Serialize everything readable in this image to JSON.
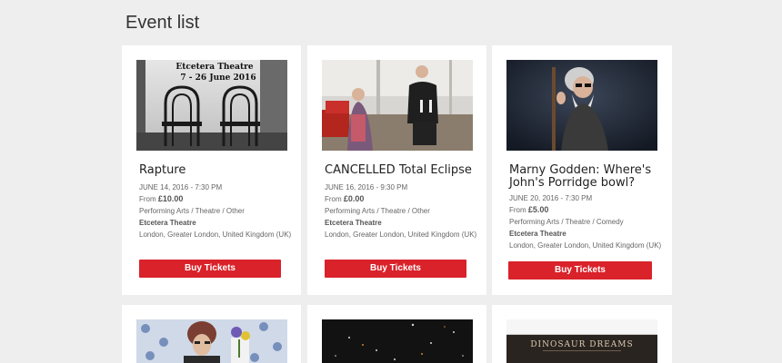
{
  "page": {
    "title": "Event list"
  },
  "events": [
    {
      "title": "Rapture",
      "date": "JUNE 14, 2016 - 7:30 PM",
      "price_prefix": "From",
      "price": "£10.00",
      "category": "Performing Arts / Theatre / Other",
      "venue": "Etcetera Theatre",
      "location": "London, Greater London, United Kingdom (UK)",
      "button_label": "Buy Tickets",
      "image_caption_line1": "Etcetera Theatre",
      "image_caption_line2": "7 - 26 June 2016"
    },
    {
      "title": "CANCELLED Total Eclipse",
      "date": "JUNE 16, 2016 - 9:30 PM",
      "price_prefix": "From",
      "price": "£0.00",
      "category": "Performing Arts / Theatre / Other",
      "venue": "Etcetera Theatre",
      "location": "London, Greater London, United Kingdom (UK)",
      "button_label": "Buy Tickets"
    },
    {
      "title_line1": "Marny Godden: Where's",
      "title_line2": "John's Porridge bowl?",
      "date": "JUNE 20, 2016 - 7:30 PM",
      "price_prefix": "From",
      "price": "£5.00",
      "category": "Performing Arts / Theatre / Comedy",
      "venue": "Etcetera Theatre",
      "location": "London, Greater London, United Kingdom (UK)",
      "button_label": "Buy Tickets"
    },
    {},
    {},
    {
      "image_caption": "DINOSAUR DREAMS"
    }
  ],
  "colors": {
    "accent": "#d9222a",
    "background": "#eeeeee",
    "card": "#ffffff"
  }
}
